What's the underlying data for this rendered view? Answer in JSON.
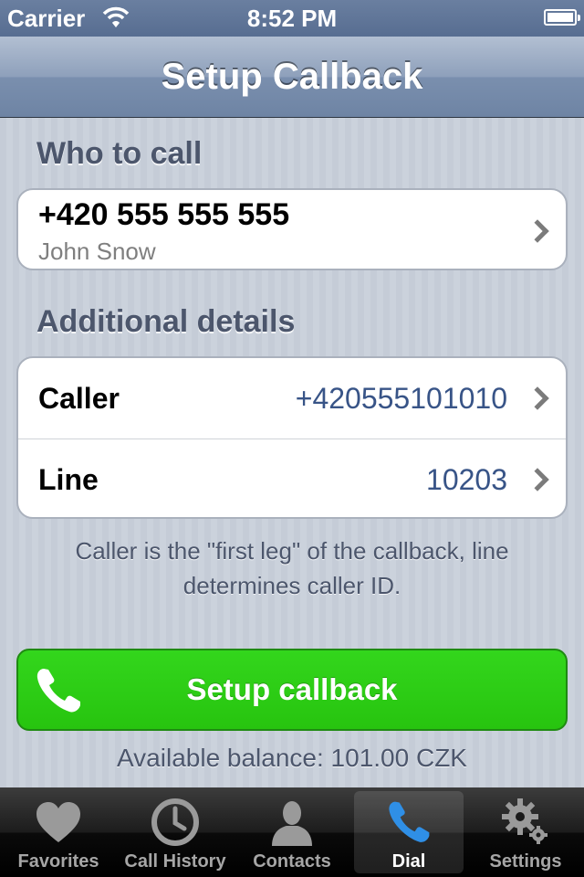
{
  "status_bar": {
    "carrier": "Carrier",
    "time": "8:52 PM"
  },
  "nav": {
    "title": "Setup Callback"
  },
  "who_to_call": {
    "header": "Who to call",
    "number": "+420 555 555 555",
    "name": "John Snow"
  },
  "additional": {
    "header": "Additional details",
    "rows": [
      {
        "label": "Caller",
        "value": "+420555101010"
      },
      {
        "label": "Line",
        "value": "10203"
      }
    ]
  },
  "note": "Caller is the \"first leg\" of the callback, line determines caller ID.",
  "callback_button": {
    "label": "Setup callback",
    "icon": "phone-icon"
  },
  "balance": "Available balance: 101.00 CZK",
  "tabs": [
    {
      "label": "Favorites",
      "icon": "heart-icon"
    },
    {
      "label": "Call History",
      "icon": "clock-icon"
    },
    {
      "label": "Contacts",
      "icon": "person-icon"
    },
    {
      "label": "Dial",
      "icon": "phone-icon",
      "active": true
    },
    {
      "label": "Settings",
      "icon": "gear-icon"
    }
  ],
  "colors": {
    "accent_green": "#2ecf17",
    "value_blue": "#385487",
    "active_tab_icon": "#2f8fe6"
  }
}
